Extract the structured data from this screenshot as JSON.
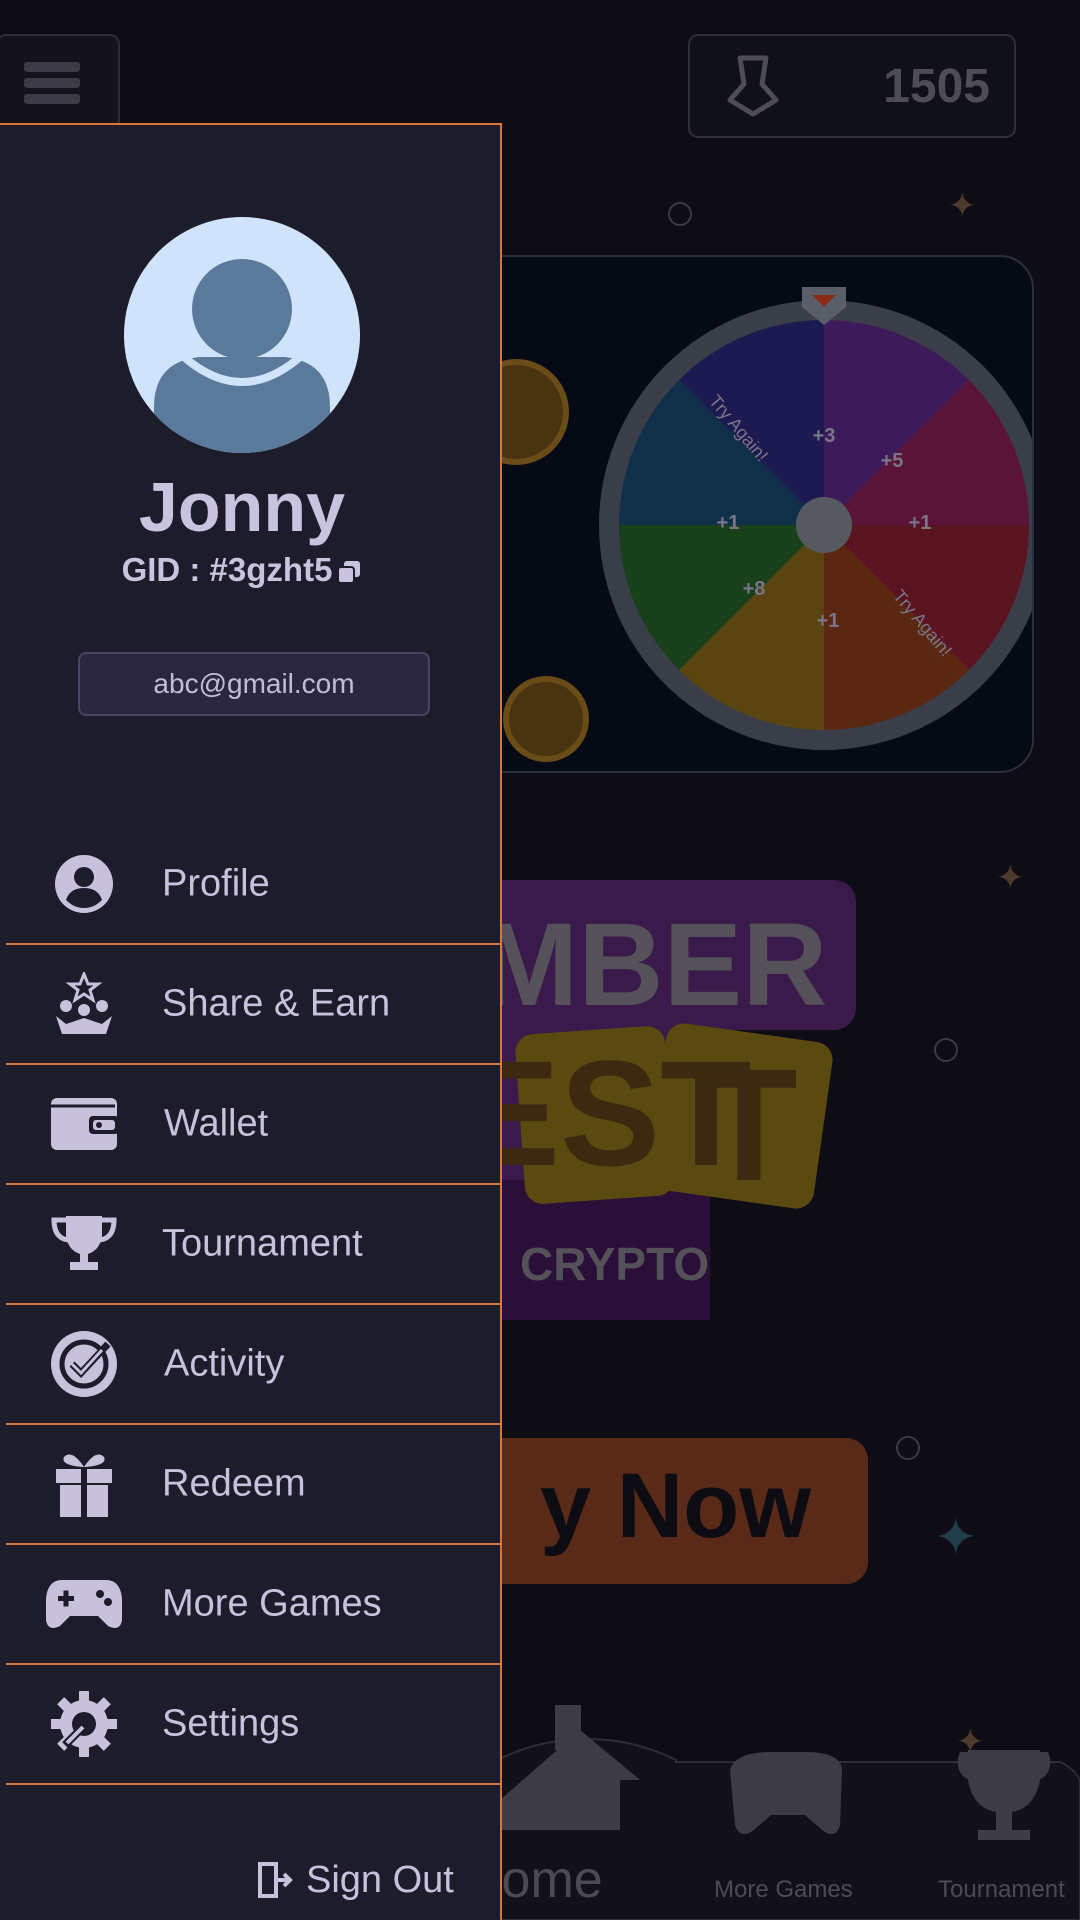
{
  "header": {
    "score": "1505",
    "menu_icon": "hamburger-icon",
    "score_icon": "axe-icon"
  },
  "wheel": {
    "segments": [
      "+3",
      "+5",
      "+1",
      "Try Again!",
      "+1",
      "+8",
      "+1",
      "Try Again!"
    ]
  },
  "banner": {
    "line1": "MBER",
    "line2": "EST",
    "sub": "CRYPTO"
  },
  "play_button": {
    "label": "y Now"
  },
  "bottom_nav": {
    "home_label": "lome",
    "more_games_label": "More Games",
    "tournament_label": "Tournament"
  },
  "drawer": {
    "user_name": "Jonny",
    "gid": "GID : #3gzht5",
    "email": "abc@gmail.com",
    "menu": [
      {
        "label": "Profile",
        "icon": "profile-icon"
      },
      {
        "label": "Share & Earn",
        "icon": "share-earn-icon"
      },
      {
        "label": "Wallet",
        "icon": "wallet-icon"
      },
      {
        "label": "Tournament",
        "icon": "trophy-icon"
      },
      {
        "label": "Activity",
        "icon": "activity-icon"
      },
      {
        "label": "Redeem",
        "icon": "gift-icon"
      },
      {
        "label": "More Games",
        "icon": "gamepad-icon"
      },
      {
        "label": "Settings",
        "icon": "settings-icon"
      }
    ],
    "sign_out": "Sign Out"
  },
  "colors": {
    "accent": "#d9753a",
    "drawer_bg": "#1d1c2b",
    "text": "#c7c1dc"
  }
}
